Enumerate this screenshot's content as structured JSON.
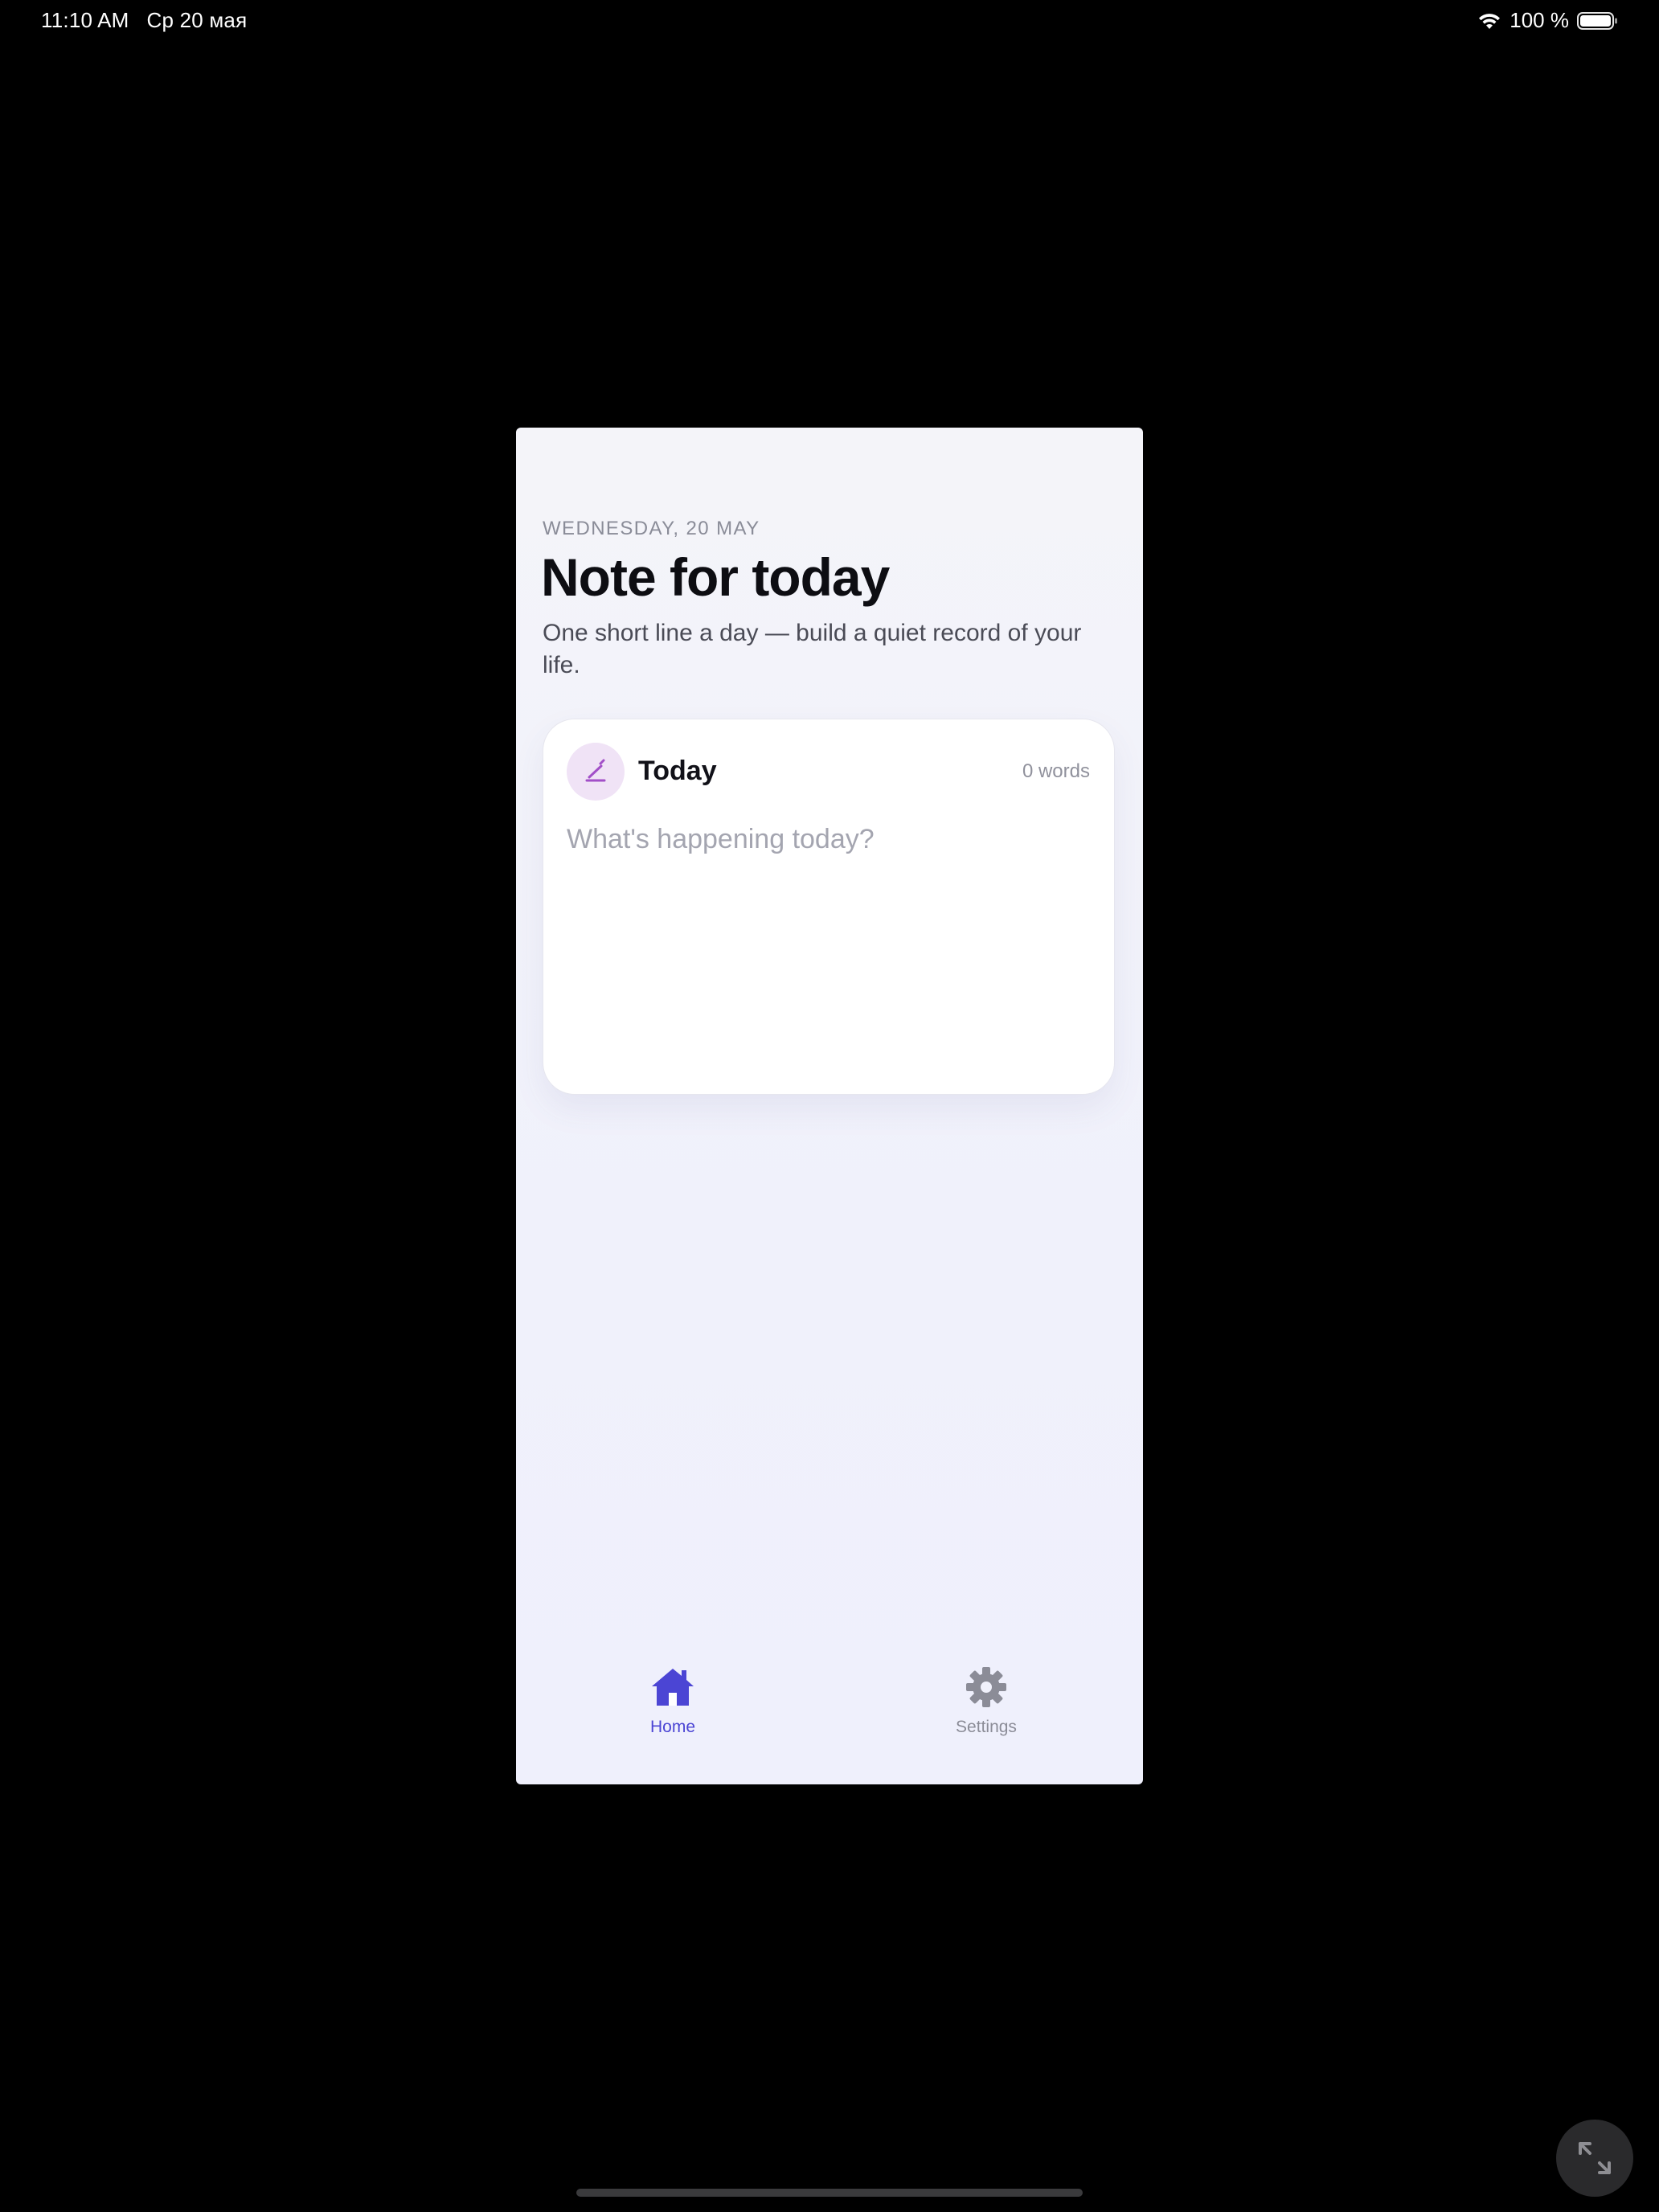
{
  "status_bar": {
    "time": "11:10 AM",
    "date": "Ср 20 мая",
    "battery": "100 %",
    "wifi_icon": "wifi-icon",
    "battery_icon": "battery-full-icon"
  },
  "app": {
    "date_label": "WEDNESDAY, 20 MAY",
    "title": "Note for today",
    "subtitle": "One short line a day — build a quiet record of your life.",
    "card": {
      "icon": "pencil-icon",
      "title": "Today",
      "word_count": "0 words",
      "input_placeholder": "What's happening today?",
      "input_value": ""
    },
    "tabs": [
      {
        "label": "Home",
        "icon": "home-icon",
        "active": true
      },
      {
        "label": "Settings",
        "icon": "gear-icon",
        "active": false
      }
    ]
  },
  "colors": {
    "accent": "#4b45d4",
    "inactive": "#8b8c97",
    "avatar_bg": "#f0e3f6",
    "pencil": "#a24fc8",
    "background": "#f2f2fa"
  },
  "system": {
    "expand_icon": "expand-arrows-icon"
  }
}
